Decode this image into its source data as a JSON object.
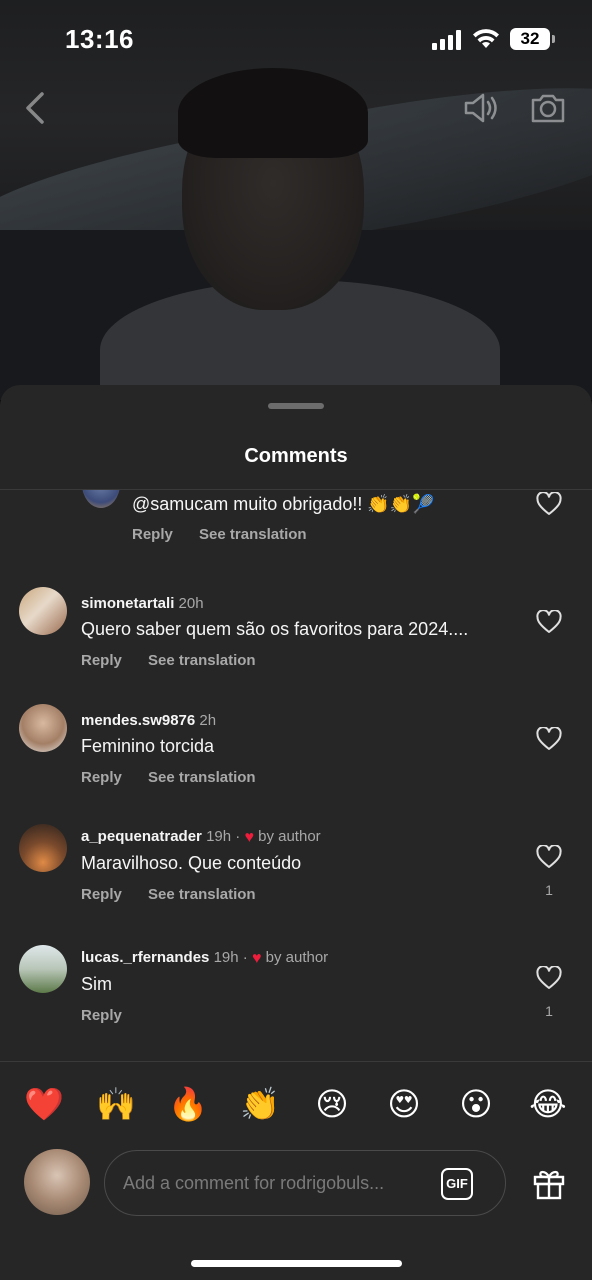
{
  "status_bar": {
    "time": "13:16",
    "battery": "32"
  },
  "sheet": {
    "title": "Comments"
  },
  "comments": [
    {
      "user": "",
      "time": "",
      "text": "@samucam muito obrigado!! 👏👏🎾",
      "reply": "Reply",
      "translate": "See translation",
      "likes": "",
      "liked_by_author": false
    },
    {
      "user": "simonetartali",
      "time": "20h",
      "text": "Quero saber quem são os favoritos para 2024....",
      "reply": "Reply",
      "translate": "See translation",
      "likes": "",
      "liked_by_author": false
    },
    {
      "user": "mendes.sw9876",
      "time": "2h",
      "text": "Feminino torcida",
      "reply": "Reply",
      "translate": "See translation",
      "likes": "",
      "liked_by_author": false
    },
    {
      "user": "a_pequenatrader",
      "time": "19h",
      "text": "Maravilhoso. Que conteúdo",
      "reply": "Reply",
      "translate": "See translation",
      "likes": "1",
      "liked_by_author": true,
      "author_label": "by author"
    },
    {
      "user": "lucas._rfernandes",
      "time": "19h",
      "text": "Sim",
      "reply": "Reply",
      "translate": "",
      "likes": "1",
      "liked_by_author": true,
      "author_label": "by author"
    }
  ],
  "reactions": [
    "❤️",
    "🙌",
    "🔥",
    "👏",
    "😢",
    "😍",
    "😮",
    "😂"
  ],
  "composer": {
    "placeholder": "Add a comment for rodrigobuls...",
    "gif_label": "GIF"
  },
  "colors": {
    "sheet_bg": "#262626",
    "author_heart": "#ee1d3c"
  }
}
